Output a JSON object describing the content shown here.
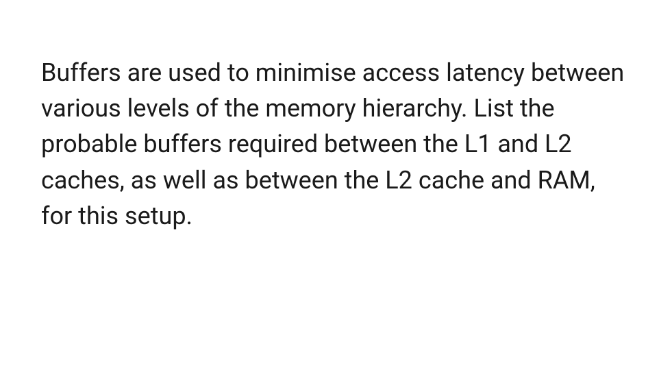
{
  "content": {
    "paragraph": "Buffers are used to minimise access latency between various levels of the memory hierarchy. List the probable buffers required between the L1 and L2 caches, as well as between the L2 cache and RAM, for this setup."
  }
}
